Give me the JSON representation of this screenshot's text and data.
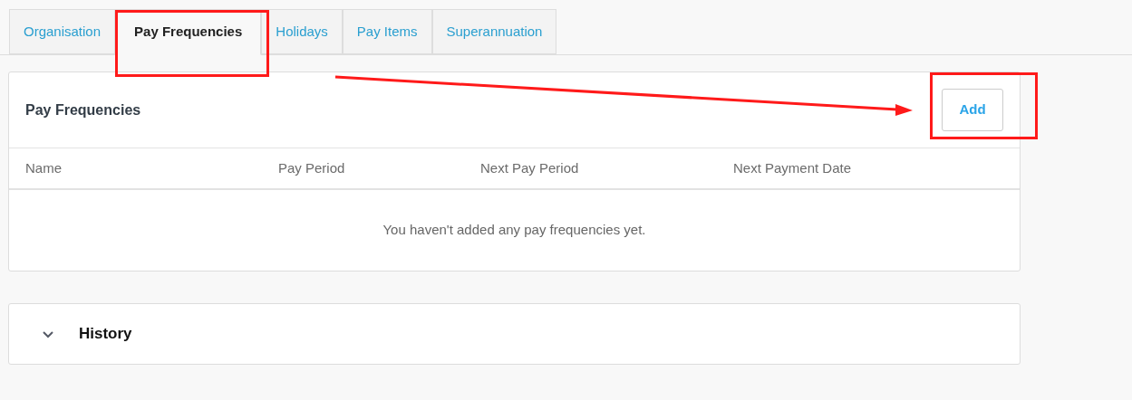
{
  "tabs": [
    {
      "label": "Organisation",
      "selected": false
    },
    {
      "label": "Pay Frequencies",
      "selected": true
    },
    {
      "label": "Holidays",
      "selected": false
    },
    {
      "label": "Pay Items",
      "selected": false
    },
    {
      "label": "Superannuation",
      "selected": false
    }
  ],
  "pay_frequencies": {
    "title": "Pay Frequencies",
    "add_button": "Add",
    "columns": [
      "Name",
      "Pay Period",
      "Next Pay Period",
      "Next Payment Date"
    ],
    "empty_message": "You haven't added any pay frequencies yet."
  },
  "history": {
    "title": "History",
    "expanded": false
  }
}
